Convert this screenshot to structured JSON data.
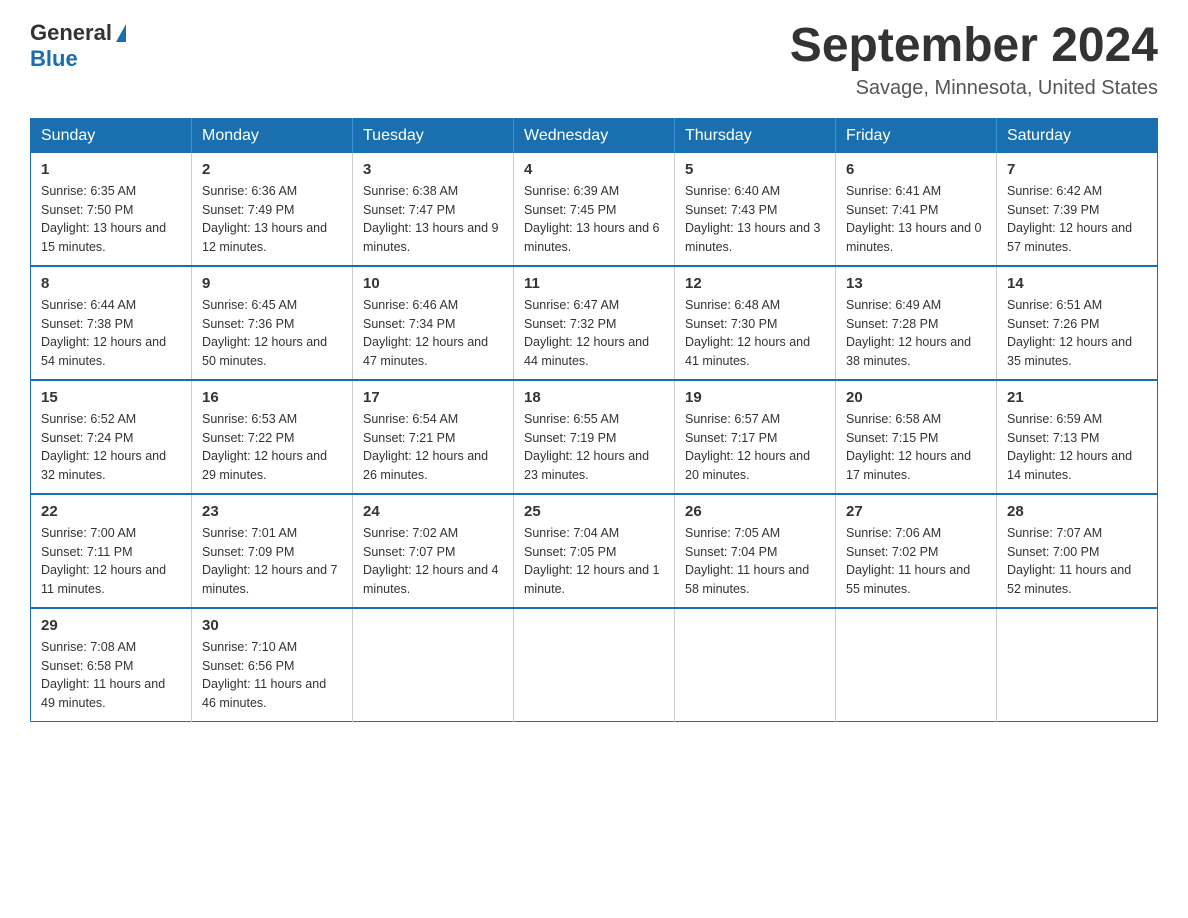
{
  "logo": {
    "general": "General",
    "blue": "Blue"
  },
  "header": {
    "title": "September 2024",
    "subtitle": "Savage, Minnesota, United States"
  },
  "weekdays": [
    "Sunday",
    "Monday",
    "Tuesday",
    "Wednesday",
    "Thursday",
    "Friday",
    "Saturday"
  ],
  "weeks": [
    [
      {
        "day": "1",
        "sunrise": "6:35 AM",
        "sunset": "7:50 PM",
        "daylight": "13 hours and 15 minutes."
      },
      {
        "day": "2",
        "sunrise": "6:36 AM",
        "sunset": "7:49 PM",
        "daylight": "13 hours and 12 minutes."
      },
      {
        "day": "3",
        "sunrise": "6:38 AM",
        "sunset": "7:47 PM",
        "daylight": "13 hours and 9 minutes."
      },
      {
        "day": "4",
        "sunrise": "6:39 AM",
        "sunset": "7:45 PM",
        "daylight": "13 hours and 6 minutes."
      },
      {
        "day": "5",
        "sunrise": "6:40 AM",
        "sunset": "7:43 PM",
        "daylight": "13 hours and 3 minutes."
      },
      {
        "day": "6",
        "sunrise": "6:41 AM",
        "sunset": "7:41 PM",
        "daylight": "13 hours and 0 minutes."
      },
      {
        "day": "7",
        "sunrise": "6:42 AM",
        "sunset": "7:39 PM",
        "daylight": "12 hours and 57 minutes."
      }
    ],
    [
      {
        "day": "8",
        "sunrise": "6:44 AM",
        "sunset": "7:38 PM",
        "daylight": "12 hours and 54 minutes."
      },
      {
        "day": "9",
        "sunrise": "6:45 AM",
        "sunset": "7:36 PM",
        "daylight": "12 hours and 50 minutes."
      },
      {
        "day": "10",
        "sunrise": "6:46 AM",
        "sunset": "7:34 PM",
        "daylight": "12 hours and 47 minutes."
      },
      {
        "day": "11",
        "sunrise": "6:47 AM",
        "sunset": "7:32 PM",
        "daylight": "12 hours and 44 minutes."
      },
      {
        "day": "12",
        "sunrise": "6:48 AM",
        "sunset": "7:30 PM",
        "daylight": "12 hours and 41 minutes."
      },
      {
        "day": "13",
        "sunrise": "6:49 AM",
        "sunset": "7:28 PM",
        "daylight": "12 hours and 38 minutes."
      },
      {
        "day": "14",
        "sunrise": "6:51 AM",
        "sunset": "7:26 PM",
        "daylight": "12 hours and 35 minutes."
      }
    ],
    [
      {
        "day": "15",
        "sunrise": "6:52 AM",
        "sunset": "7:24 PM",
        "daylight": "12 hours and 32 minutes."
      },
      {
        "day": "16",
        "sunrise": "6:53 AM",
        "sunset": "7:22 PM",
        "daylight": "12 hours and 29 minutes."
      },
      {
        "day": "17",
        "sunrise": "6:54 AM",
        "sunset": "7:21 PM",
        "daylight": "12 hours and 26 minutes."
      },
      {
        "day": "18",
        "sunrise": "6:55 AM",
        "sunset": "7:19 PM",
        "daylight": "12 hours and 23 minutes."
      },
      {
        "day": "19",
        "sunrise": "6:57 AM",
        "sunset": "7:17 PM",
        "daylight": "12 hours and 20 minutes."
      },
      {
        "day": "20",
        "sunrise": "6:58 AM",
        "sunset": "7:15 PM",
        "daylight": "12 hours and 17 minutes."
      },
      {
        "day": "21",
        "sunrise": "6:59 AM",
        "sunset": "7:13 PM",
        "daylight": "12 hours and 14 minutes."
      }
    ],
    [
      {
        "day": "22",
        "sunrise": "7:00 AM",
        "sunset": "7:11 PM",
        "daylight": "12 hours and 11 minutes."
      },
      {
        "day": "23",
        "sunrise": "7:01 AM",
        "sunset": "7:09 PM",
        "daylight": "12 hours and 7 minutes."
      },
      {
        "day": "24",
        "sunrise": "7:02 AM",
        "sunset": "7:07 PM",
        "daylight": "12 hours and 4 minutes."
      },
      {
        "day": "25",
        "sunrise": "7:04 AM",
        "sunset": "7:05 PM",
        "daylight": "12 hours and 1 minute."
      },
      {
        "day": "26",
        "sunrise": "7:05 AM",
        "sunset": "7:04 PM",
        "daylight": "11 hours and 58 minutes."
      },
      {
        "day": "27",
        "sunrise": "7:06 AM",
        "sunset": "7:02 PM",
        "daylight": "11 hours and 55 minutes."
      },
      {
        "day": "28",
        "sunrise": "7:07 AM",
        "sunset": "7:00 PM",
        "daylight": "11 hours and 52 minutes."
      }
    ],
    [
      {
        "day": "29",
        "sunrise": "7:08 AM",
        "sunset": "6:58 PM",
        "daylight": "11 hours and 49 minutes."
      },
      {
        "day": "30",
        "sunrise": "7:10 AM",
        "sunset": "6:56 PM",
        "daylight": "11 hours and 46 minutes."
      },
      null,
      null,
      null,
      null,
      null
    ]
  ]
}
